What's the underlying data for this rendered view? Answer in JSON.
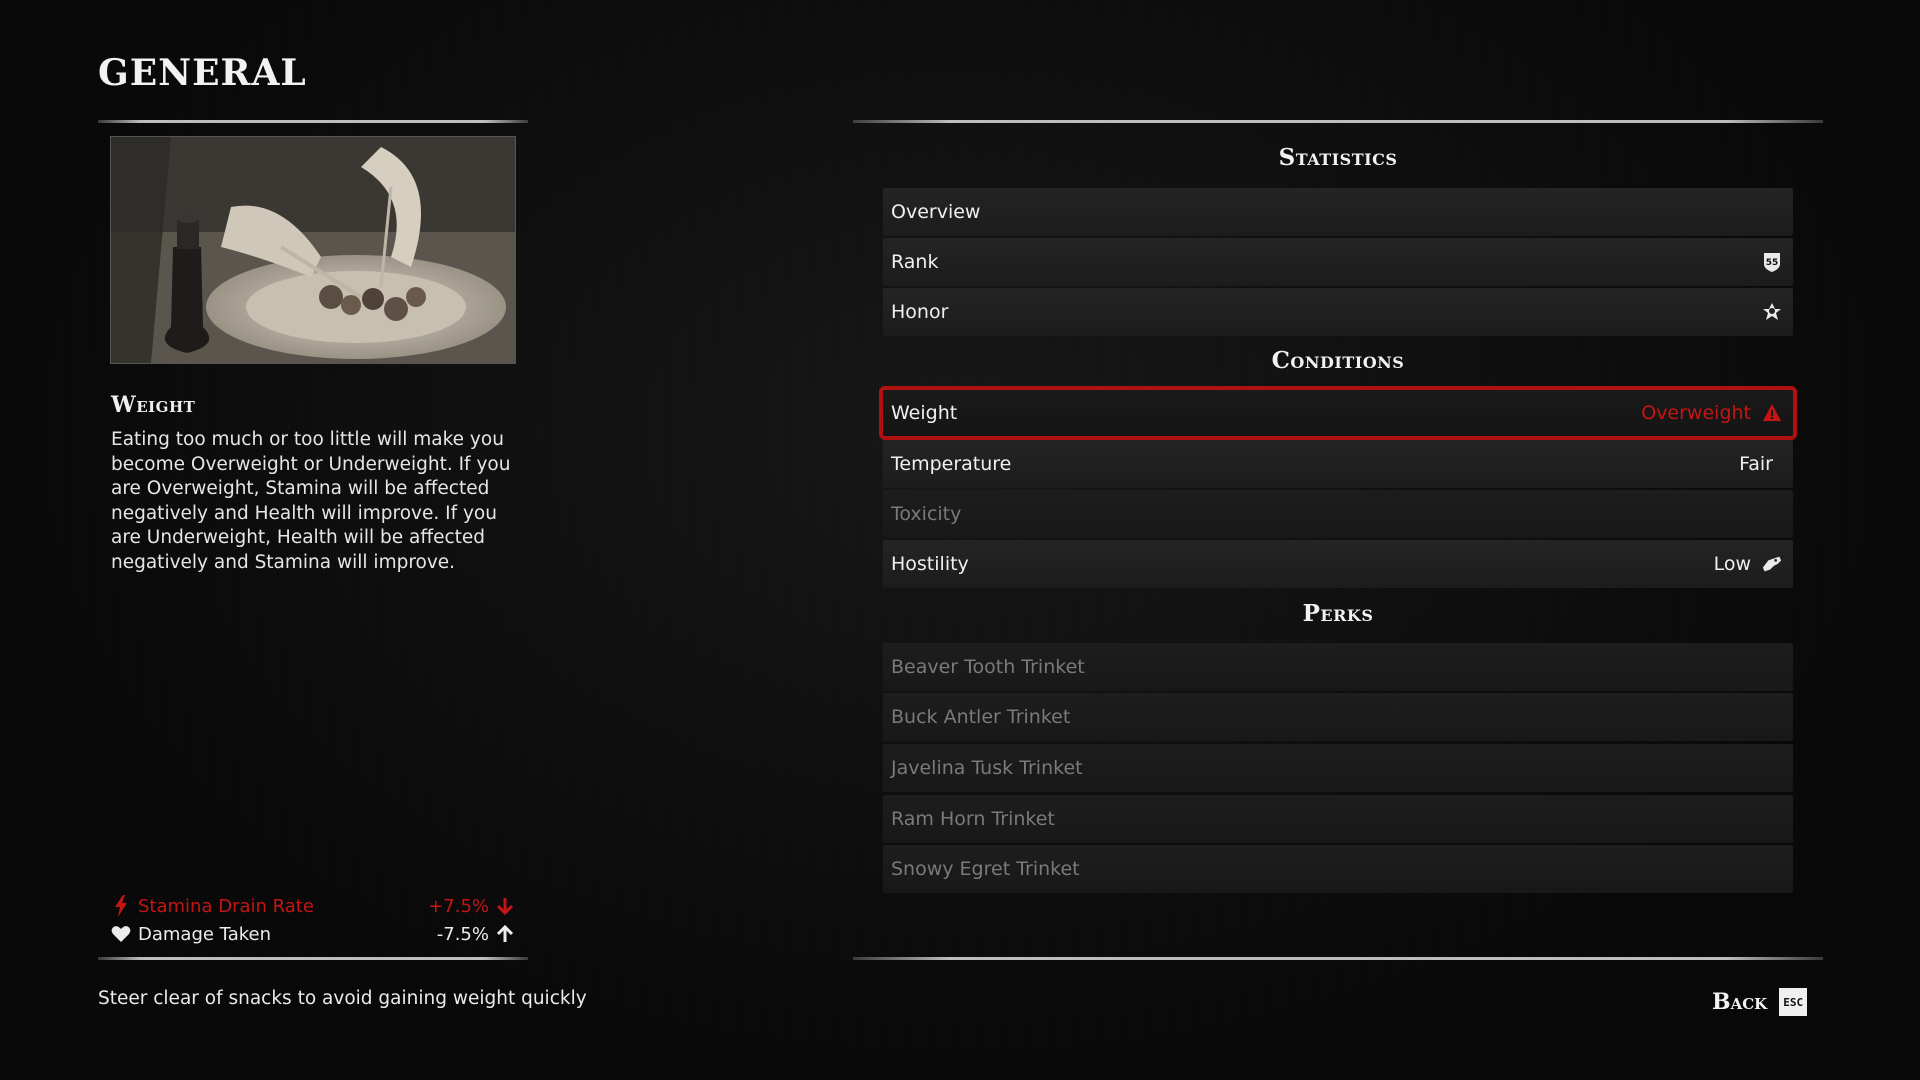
{
  "page_title": "GENERAL",
  "info": {
    "title": "Weight",
    "description": "Eating too much or too little will make you become Overweight or Underweight. If you are Overweight, Stamina will be affected negatively and Health will improve. If you are Underweight, Health will be affected negatively and Stamina will improve.",
    "image_icon": "dining-illustration",
    "effects": [
      {
        "label": "Stamina Drain Rate",
        "value": "+7.5%",
        "icon": "lightning-icon",
        "arrow": "arrow-down-icon",
        "color": "#c41515"
      },
      {
        "label": "Damage Taken",
        "value": "-7.5%",
        "icon": "heart-icon",
        "arrow": "arrow-up-icon",
        "color": "#ececec"
      }
    ]
  },
  "tip": "Steer clear of snacks to avoid gaining weight quickly",
  "sections": {
    "statistics": {
      "header": "Statistics",
      "rows": [
        {
          "name": "Overview",
          "value": ""
        },
        {
          "name": "Rank",
          "value": "",
          "badge": "55",
          "icon": "rank-badge-icon"
        },
        {
          "name": "Honor",
          "value": "",
          "icon": "honor-icon"
        }
      ]
    },
    "conditions": {
      "header": "Conditions",
      "rows": [
        {
          "name": "Weight",
          "value": "Overweight",
          "icon": "warning-icon",
          "selected": true
        },
        {
          "name": "Temperature",
          "value": "Fair"
        },
        {
          "name": "Toxicity",
          "value": "",
          "disabled": true
        },
        {
          "name": "Hostility",
          "value": "Low",
          "icon": "hostility-icon"
        }
      ]
    },
    "perks": {
      "header": "Perks",
      "rows": [
        {
          "name": "Beaver Tooth Trinket",
          "disabled": true
        },
        {
          "name": "Buck Antler Trinket",
          "disabled": true
        },
        {
          "name": "Javelina Tusk Trinket",
          "disabled": true
        },
        {
          "name": "Ram Horn Trinket",
          "disabled": true
        },
        {
          "name": "Snowy Egret Trinket",
          "disabled": true
        }
      ]
    }
  },
  "back": {
    "label": "Back",
    "key": "ESC"
  },
  "colors": {
    "accent_red": "#b01010",
    "text": "#f0f0f0",
    "disabled_text": "#7a7a7a"
  }
}
